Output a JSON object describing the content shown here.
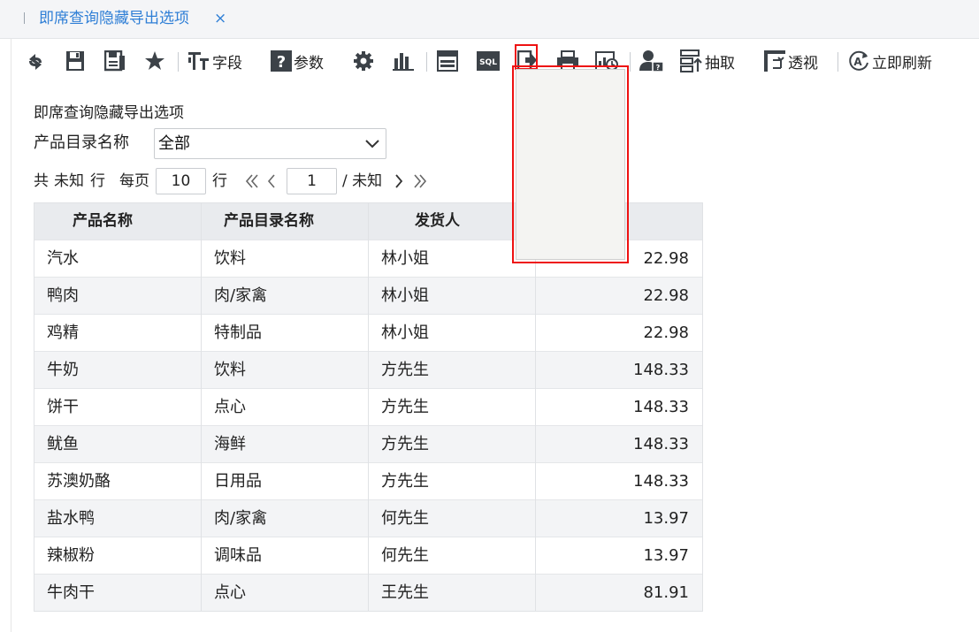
{
  "tab": {
    "label": "即席查询隐藏导出选项",
    "close": "×"
  },
  "toolbar": {
    "field_label": "字段",
    "param_label": "参数",
    "sql_label": "SQL",
    "extract_label": "抽取",
    "pivot_label": "透视",
    "refresh_label": "立即刷新",
    "icons": [
      "refresh-icon",
      "save-icon",
      "save-as-icon",
      "star-icon",
      "field-icon",
      "param-icon",
      "settings-icon",
      "chart-icon",
      "layout-icon",
      "sql-icon",
      "export-icon",
      "print-icon",
      "schedule-icon",
      "user-permission-icon",
      "extract-icon",
      "pivot-icon",
      "auto-refresh-icon"
    ]
  },
  "report": {
    "title": "即席查询隐藏导出选项",
    "param": {
      "label": "产品目录名称",
      "value": "全部"
    }
  },
  "pager": {
    "total_prefix": "共",
    "total_value": "未知",
    "total_suffix": "行",
    "per_page_label": "每页",
    "per_page_value": "10",
    "per_page_suffix": "行",
    "current_page": "1",
    "page_total": "/ 未知"
  },
  "table": {
    "headers": [
      "产品名称",
      "产品目录名称",
      "发货人",
      ""
    ],
    "rows": [
      [
        "汽水",
        "饮料",
        "林小姐",
        "22.98"
      ],
      [
        "鸭肉",
        "肉/家禽",
        "林小姐",
        "22.98"
      ],
      [
        "鸡精",
        "特制品",
        "林小姐",
        "22.98"
      ],
      [
        "牛奶",
        "饮料",
        "方先生",
        "148.33"
      ],
      [
        "饼干",
        "点心",
        "方先生",
        "148.33"
      ],
      [
        "鱿鱼",
        "海鲜",
        "方先生",
        "148.33"
      ],
      [
        "苏澳奶酪",
        "日用品",
        "方先生",
        "148.33"
      ],
      [
        "盐水鸭",
        "肉/家禽",
        "何先生",
        "13.97"
      ],
      [
        "辣椒粉",
        "调味品",
        "何先生",
        "13.97"
      ],
      [
        "牛肉干",
        "点心",
        "王先生",
        "81.91"
      ]
    ]
  },
  "colors": {
    "accent": "#2f7fd6",
    "highlight": "#ee1111",
    "header_bg": "#e9ebee"
  }
}
